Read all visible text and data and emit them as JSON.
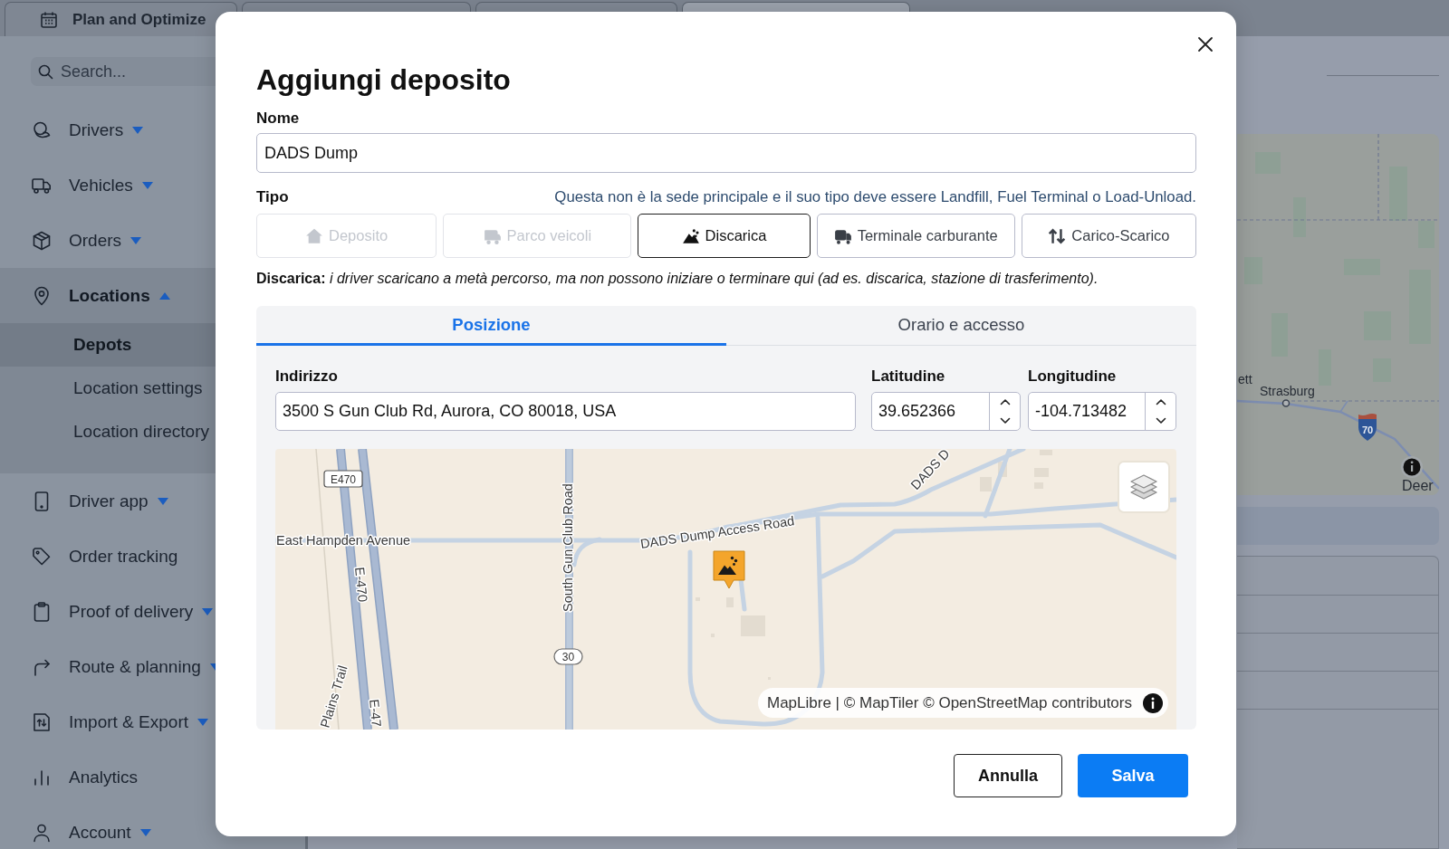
{
  "top_tabs": [
    {
      "kind": "labeled",
      "label": "Plan and Optimize",
      "selected": false
    },
    {
      "kind": "blank",
      "selected": false
    },
    {
      "kind": "blank",
      "selected": false
    },
    {
      "kind": "blank",
      "selected": true
    }
  ],
  "sidebar": {
    "search": {
      "placeholder": "Search..."
    },
    "items": [
      {
        "kind": "group",
        "label": "Drivers",
        "expanded": false,
        "selected": false
      },
      {
        "kind": "group",
        "label": "Vehicles",
        "expanded": false,
        "selected": false
      },
      {
        "kind": "group",
        "label": "Orders",
        "expanded": false,
        "selected": false
      },
      {
        "kind": "group",
        "label": "Locations",
        "expanded": true,
        "selected": true,
        "children": [
          {
            "label": "Depots",
            "selected": true
          },
          {
            "label": "Location settings",
            "selected": false
          },
          {
            "label": "Location directory",
            "selected": false
          }
        ]
      },
      {
        "kind": "group",
        "label": "Driver app",
        "expanded": false,
        "selected": false
      },
      {
        "kind": "link",
        "label": "Order tracking",
        "selected": false
      },
      {
        "kind": "group",
        "label": "Proof of delivery",
        "expanded": false,
        "selected": false
      },
      {
        "kind": "group",
        "label": "Route & planning",
        "expanded": false,
        "selected": false
      },
      {
        "kind": "group",
        "label": "Import & Export",
        "expanded": false,
        "selected": false
      },
      {
        "kind": "link",
        "label": "Analytics",
        "selected": false
      },
      {
        "kind": "group",
        "label": "Account",
        "expanded": false,
        "selected": false
      }
    ]
  },
  "background_map": {
    "labels": [
      "ett",
      "Strasburg",
      "Deer"
    ],
    "shield": "70"
  },
  "dialog": {
    "title": "Aggiungi deposito",
    "name": {
      "label": "Nome",
      "value": "DADS Dump"
    },
    "type": {
      "label": "Tipo",
      "hint": "Questa non è la sede principale e il suo tipo deve essere Landfill, Fuel Terminal o Load-Unload.",
      "options": [
        {
          "label": "Deposito",
          "selected": false,
          "disabled": true
        },
        {
          "label": "Parco veicoli",
          "selected": false,
          "disabled": true
        },
        {
          "label": "Discarica",
          "selected": true,
          "disabled": false
        },
        {
          "label": "Terminale carburante",
          "selected": false,
          "disabled": false
        },
        {
          "label": "Carico-Scarico",
          "selected": false,
          "disabled": false
        }
      ],
      "description": "**Discarica:** *i driver scaricano a metà percorso, ma non possono iniziare o terminare qui (ad es. discarica, stazione di trasferimento).*"
    },
    "tabs": [
      {
        "label": "Posizione",
        "selected": true
      },
      {
        "label": "Orario e accesso",
        "selected": false
      }
    ],
    "address": {
      "label": "Indirizzo",
      "value": "3500 S Gun Club Rd, Aurora, CO 80018, USA"
    },
    "latitude": {
      "label": "Latitudine",
      "value": "39.652366"
    },
    "longitude": {
      "label": "Longitudine",
      "value": "-104.713482"
    },
    "map": {
      "labels": [
        "East Hampden Avenue",
        "South Gun Club Road",
        "DADS Dump Access Road",
        "DADS D",
        "E-470",
        "E-47",
        "Plains Trail"
      ],
      "shields": [
        "E470",
        "30"
      ],
      "attribution": "MapLibre | © MapTiler © OpenStreetMap contributors"
    },
    "buttons": [
      {
        "kind": "secondary",
        "label": "Annulla"
      },
      {
        "kind": "primary",
        "label": "Salva"
      }
    ]
  }
}
